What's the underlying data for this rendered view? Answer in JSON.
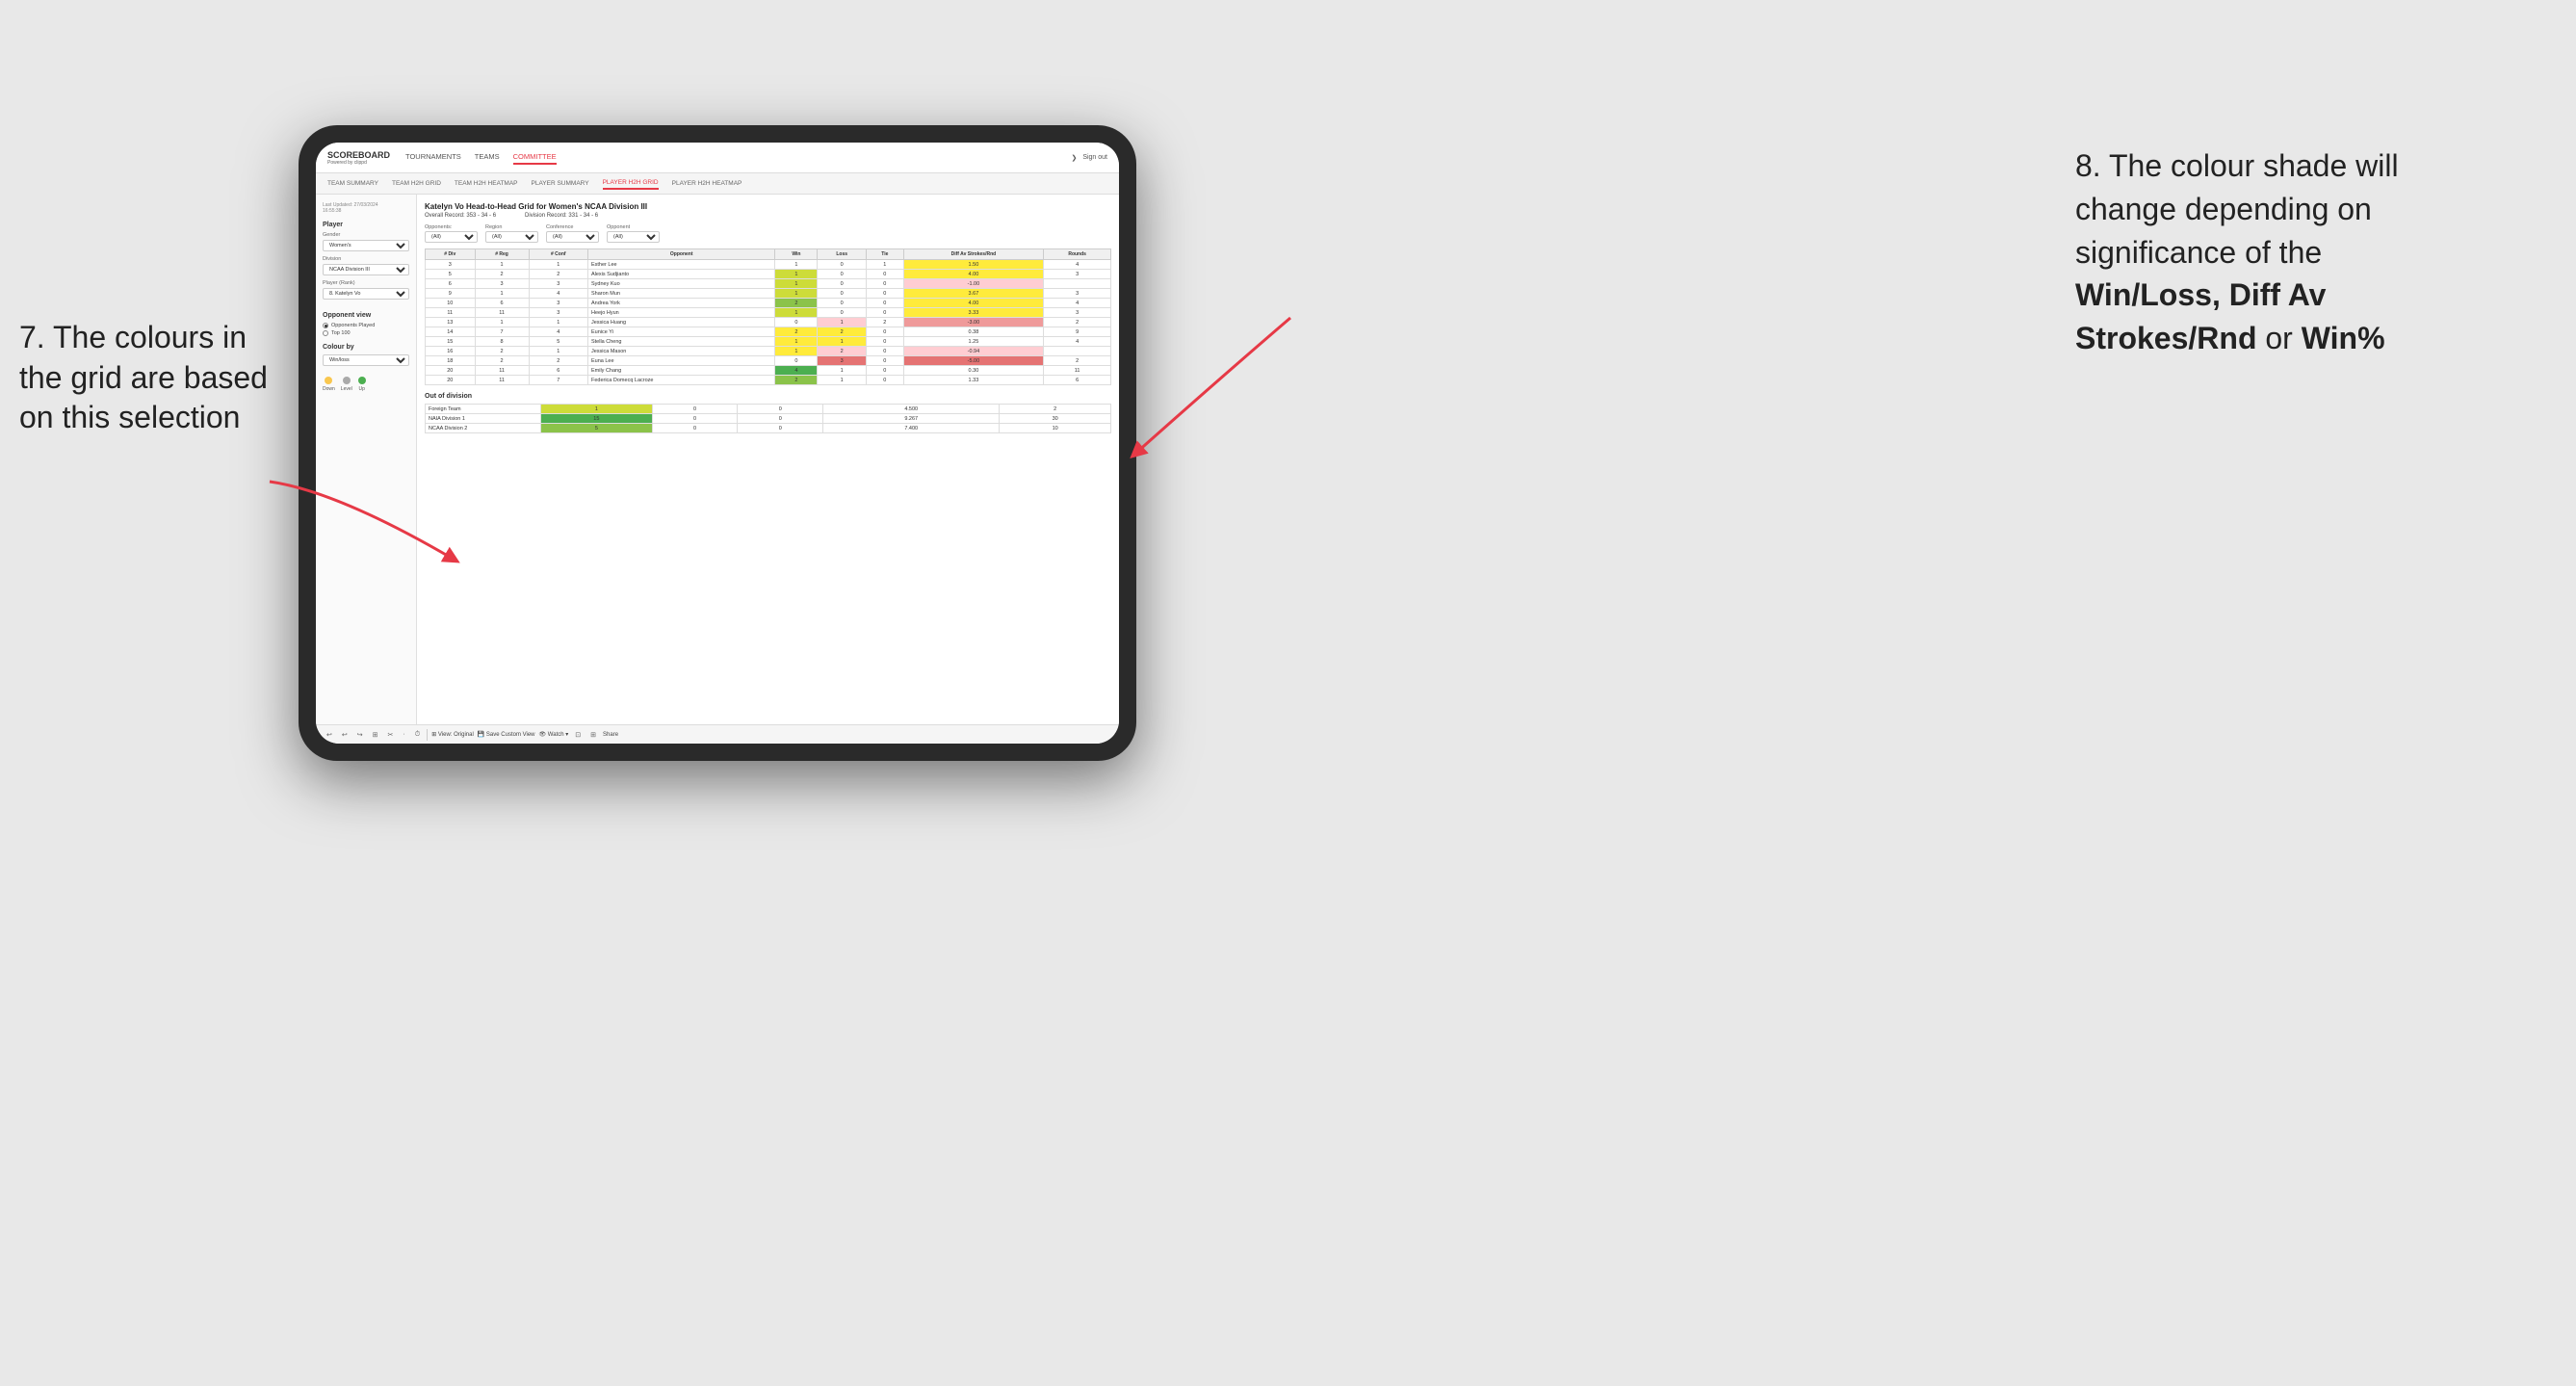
{
  "annotation": {
    "left_title": "7. The colours in the grid are based on this selection",
    "right_title": "8. The colour shade will change depending on significance of the",
    "right_bold1": "Win/Loss, Diff Av Strokes/Rnd",
    "right_or": "or",
    "right_bold2": "Win%"
  },
  "navbar": {
    "logo": "SCOREBOARD",
    "logo_sub": "Powered by clippd",
    "links": [
      "TOURNAMENTS",
      "TEAMS",
      "COMMITTEE"
    ],
    "active_link": "COMMITTEE",
    "sign_in_icon": "❯",
    "sign_out": "Sign out"
  },
  "subnav": {
    "links": [
      "TEAM SUMMARY",
      "TEAM H2H GRID",
      "TEAM H2H HEATMAP",
      "PLAYER SUMMARY",
      "PLAYER H2H GRID",
      "PLAYER H2H HEATMAP"
    ],
    "active_link": "PLAYER H2H GRID"
  },
  "left_panel": {
    "last_updated_label": "Last Updated: 27/03/2024",
    "last_updated_time": "16:55:38",
    "player_title": "Player",
    "gender_label": "Gender",
    "gender_value": "Women's",
    "division_label": "Division",
    "division_value": "NCAA Division III",
    "player_rank_label": "Player (Rank)",
    "player_rank_value": "8. Katelyn Vo",
    "opponent_view_title": "Opponent view",
    "opponents_played_label": "Opponents Played",
    "top100_label": "Top 100",
    "colour_by_title": "Colour by",
    "colour_by_value": "Win/loss",
    "legend": {
      "down_label": "Down",
      "down_color": "#f9c74f",
      "level_label": "Level",
      "level_color": "#aaaaaa",
      "up_label": "Up",
      "up_color": "#4caf50"
    }
  },
  "main": {
    "title": "Katelyn Vo Head-to-Head Grid for Women's NCAA Division III",
    "overall_record_label": "Overall Record:",
    "overall_record_value": "353 - 34 - 6",
    "division_record_label": "Division Record:",
    "division_record_value": "331 - 34 - 6",
    "filters": {
      "opponents_label": "Opponents:",
      "opponents_value": "(All)",
      "region_label": "Region",
      "region_value": "(All)",
      "conference_label": "Conference",
      "conference_value": "(All)",
      "opponent_label": "Opponent",
      "opponent_value": "(All)"
    },
    "table_headers": [
      "# Div",
      "# Reg",
      "# Conf",
      "Opponent",
      "Win",
      "Loss",
      "Tie",
      "Diff Av Strokes/Rnd",
      "Rounds"
    ],
    "table_rows": [
      {
        "div": "3",
        "reg": "1",
        "conf": "1",
        "opponent": "Esther Lee",
        "win": "1",
        "loss": "0",
        "tie": "1",
        "diff": "1.50",
        "rounds": "4",
        "win_color": "cell-white",
        "loss_color": "cell-white",
        "diff_color": "cell-yellow"
      },
      {
        "div": "5",
        "reg": "2",
        "conf": "2",
        "opponent": "Alexis Sudjianto",
        "win": "1",
        "loss": "0",
        "tie": "0",
        "diff": "4.00",
        "rounds": "3",
        "win_color": "cell-green-light",
        "loss_color": "cell-white",
        "diff_color": "cell-yellow"
      },
      {
        "div": "6",
        "reg": "3",
        "conf": "3",
        "opponent": "Sydney Kuo",
        "win": "1",
        "loss": "0",
        "tie": "0",
        "diff": "-1.00",
        "rounds": "",
        "win_color": "cell-green-light",
        "loss_color": "cell-white",
        "diff_color": "cell-red-light"
      },
      {
        "div": "9",
        "reg": "1",
        "conf": "4",
        "opponent": "Sharon Mun",
        "win": "1",
        "loss": "0",
        "tie": "0",
        "diff": "3.67",
        "rounds": "3",
        "win_color": "cell-green-light",
        "loss_color": "cell-white",
        "diff_color": "cell-yellow"
      },
      {
        "div": "10",
        "reg": "6",
        "conf": "3",
        "opponent": "Andrea York",
        "win": "2",
        "loss": "0",
        "tie": "0",
        "diff": "4.00",
        "rounds": "4",
        "win_color": "cell-green-medium",
        "loss_color": "cell-white",
        "diff_color": "cell-yellow"
      },
      {
        "div": "11",
        "reg": "11",
        "conf": "3",
        "opponent": "Heejo Hyun",
        "win": "1",
        "loss": "0",
        "tie": "0",
        "diff": "3.33",
        "rounds": "3",
        "win_color": "cell-green-light",
        "loss_color": "cell-white",
        "diff_color": "cell-yellow"
      },
      {
        "div": "13",
        "reg": "1",
        "conf": "1",
        "opponent": "Jessica Huang",
        "win": "0",
        "loss": "1",
        "tie": "2",
        "diff": "-3.00",
        "rounds": "2",
        "win_color": "cell-white",
        "loss_color": "cell-red-light",
        "diff_color": "cell-red-medium"
      },
      {
        "div": "14",
        "reg": "7",
        "conf": "4",
        "opponent": "Eunice Yi",
        "win": "2",
        "loss": "2",
        "tie": "0",
        "diff": "0.38",
        "rounds": "9",
        "win_color": "cell-yellow",
        "loss_color": "cell-yellow",
        "diff_color": "cell-white"
      },
      {
        "div": "15",
        "reg": "8",
        "conf": "5",
        "opponent": "Stella Cheng",
        "win": "1",
        "loss": "1",
        "tie": "0",
        "diff": "1.25",
        "rounds": "4",
        "win_color": "cell-yellow",
        "loss_color": "cell-yellow",
        "diff_color": "cell-white"
      },
      {
        "div": "16",
        "reg": "2",
        "conf": "1",
        "opponent": "Jessica Mason",
        "win": "1",
        "loss": "2",
        "tie": "0",
        "diff": "-0.94",
        "rounds": "",
        "win_color": "cell-yellow",
        "loss_color": "cell-red-light",
        "diff_color": "cell-red-light"
      },
      {
        "div": "18",
        "reg": "2",
        "conf": "2",
        "opponent": "Euna Lee",
        "win": "0",
        "loss": "3",
        "tie": "0",
        "diff": "-5.00",
        "rounds": "2",
        "win_color": "cell-white",
        "loss_color": "cell-red-strong",
        "diff_color": "cell-red-strong"
      },
      {
        "div": "20",
        "reg": "11",
        "conf": "6",
        "opponent": "Emily Chang",
        "win": "4",
        "loss": "1",
        "tie": "0",
        "diff": "0.30",
        "rounds": "11",
        "win_color": "cell-green-strong",
        "loss_color": "cell-white",
        "diff_color": "cell-white"
      },
      {
        "div": "20",
        "reg": "11",
        "conf": "7",
        "opponent": "Federica Domecq Lacroze",
        "win": "2",
        "loss": "1",
        "tie": "0",
        "diff": "1.33",
        "rounds": "6",
        "win_color": "cell-green-medium",
        "loss_color": "cell-white",
        "diff_color": "cell-white"
      }
    ],
    "out_of_division": {
      "title": "Out of division",
      "rows": [
        {
          "opponent": "Foreign Team",
          "win": "1",
          "loss": "0",
          "tie": "0",
          "diff": "4.500",
          "rounds": "2",
          "win_color": "cell-green-light"
        },
        {
          "opponent": "NAIA Division 1",
          "win": "15",
          "loss": "0",
          "tie": "0",
          "diff": "9.267",
          "rounds": "30",
          "win_color": "cell-green-strong"
        },
        {
          "opponent": "NCAA Division 2",
          "win": "5",
          "loss": "0",
          "tie": "0",
          "diff": "7.400",
          "rounds": "10",
          "win_color": "cell-green-medium"
        }
      ]
    }
  },
  "toolbar": {
    "buttons": [
      "↩",
      "↩",
      "↪",
      "⊞",
      "✂",
      "·",
      "⏱",
      "|",
      "⊞ View: Original",
      "💾 Save Custom View",
      "👁 Watch ▾",
      "⊡",
      "⊞",
      "Share"
    ]
  }
}
